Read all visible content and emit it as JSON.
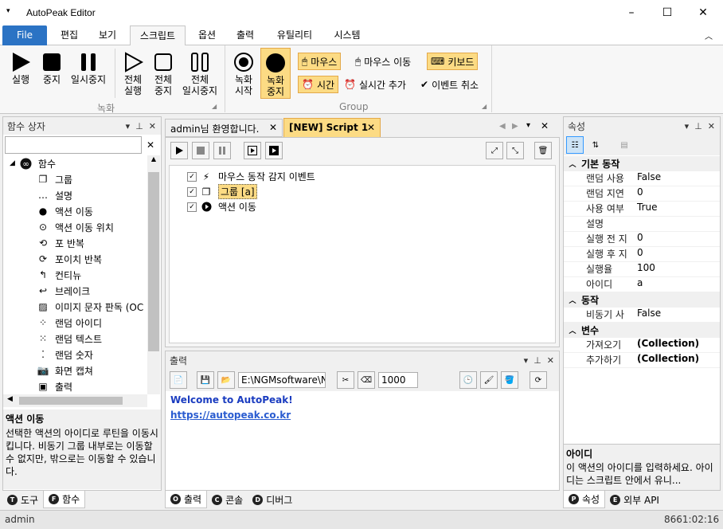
{
  "window": {
    "title": "AutoPeak Editor",
    "min": "–",
    "max": "☐",
    "close": "✕"
  },
  "menu": {
    "file": "File",
    "tabs": [
      "편집",
      "보기",
      "스크립트",
      "옵션",
      "출력",
      "유틸리티",
      "시스템"
    ]
  },
  "ribbon": {
    "record_group": "녹화",
    "group2": "Group",
    "buttons": [
      {
        "label1": "실행",
        "label2": ""
      },
      {
        "label1": "중지",
        "label2": ""
      },
      {
        "label1": "일시중지",
        "label2": ""
      },
      {
        "label1": "전체",
        "label2": "실행"
      },
      {
        "label1": "전체",
        "label2": "중지"
      },
      {
        "label1": "전체",
        "label2": "일시중지"
      },
      {
        "label1": "녹화",
        "label2": "시작"
      },
      {
        "label1": "녹화",
        "label2": "중지"
      }
    ],
    "small": {
      "mouse": "마우스",
      "mouse_move": "마우스 이동",
      "keyboard": "키보드",
      "time": "시간",
      "realtime": "실시간 추가",
      "event_cancel": "이벤트 취소"
    }
  },
  "left_panel": {
    "title": "함수 상자",
    "root": "함수",
    "items": [
      "그룹",
      "설명",
      "액션 이동",
      "액션 이동 위치",
      "포 반복",
      "포이치 반복",
      "컨티뉴",
      "브레이크",
      "이미지 문자 판독 (OC",
      "랜덤 아이디",
      "랜덤 텍스트",
      "랜덤 숫자",
      "화면 캡쳐",
      "출력"
    ],
    "desc_title": "액션 이동",
    "desc_body": "선택한 액션의 아이디로 루틴을 이동시킵니다. 비동기 그룹 내부로는 이동할 수 없지만, 밖으로는 이동할 수 있습니다.",
    "tabs": [
      {
        "c": "T",
        "label": "도구"
      },
      {
        "c": "F",
        "label": "함수"
      }
    ]
  },
  "editor": {
    "tabs": [
      "admin님 환영합니다.",
      "[NEW] Script 1"
    ],
    "rows": [
      "마우스 동작 감지 이벤트",
      "그룹 [a]",
      "액션 이동"
    ]
  },
  "output": {
    "title": "출력",
    "path": "E:\\NGMsoftware\\NG",
    "count": "1000",
    "line1": "Welcome to AutoPeak!",
    "line2": "https://autopeak.co.kr",
    "tabs": [
      {
        "c": "O",
        "label": "출력"
      },
      {
        "c": "C",
        "label": "콘솔"
      },
      {
        "c": "D",
        "label": "디버그"
      }
    ]
  },
  "props": {
    "title": "속성",
    "cat1": "기본 동작",
    "rows1": [
      [
        "랜덤 사용",
        "False"
      ],
      [
        "랜덤 지연",
        "0"
      ],
      [
        "사용 여부",
        "True"
      ],
      [
        "설명",
        ""
      ],
      [
        "실행 전 지",
        "0"
      ],
      [
        "실행 후 지",
        "0"
      ],
      [
        "실행율",
        "100"
      ],
      [
        "아이디",
        "a"
      ]
    ],
    "cat2": "동작",
    "rows2": [
      [
        "비동기 사",
        "False"
      ]
    ],
    "cat3": "변수",
    "rows3": [
      [
        "가져오기",
        "(Collection)"
      ],
      [
        "추가하기",
        "(Collection)"
      ]
    ],
    "desc_title": "아이디",
    "desc_body": "이 액션의 아이디를 입력하세요. 아이디는 스크립트 안에서 유니...",
    "tabs": [
      {
        "c": "P",
        "label": "속성"
      },
      {
        "c": "E",
        "label": "외부 API"
      }
    ]
  },
  "status": {
    "user": "admin",
    "time": "8661:02:16"
  }
}
